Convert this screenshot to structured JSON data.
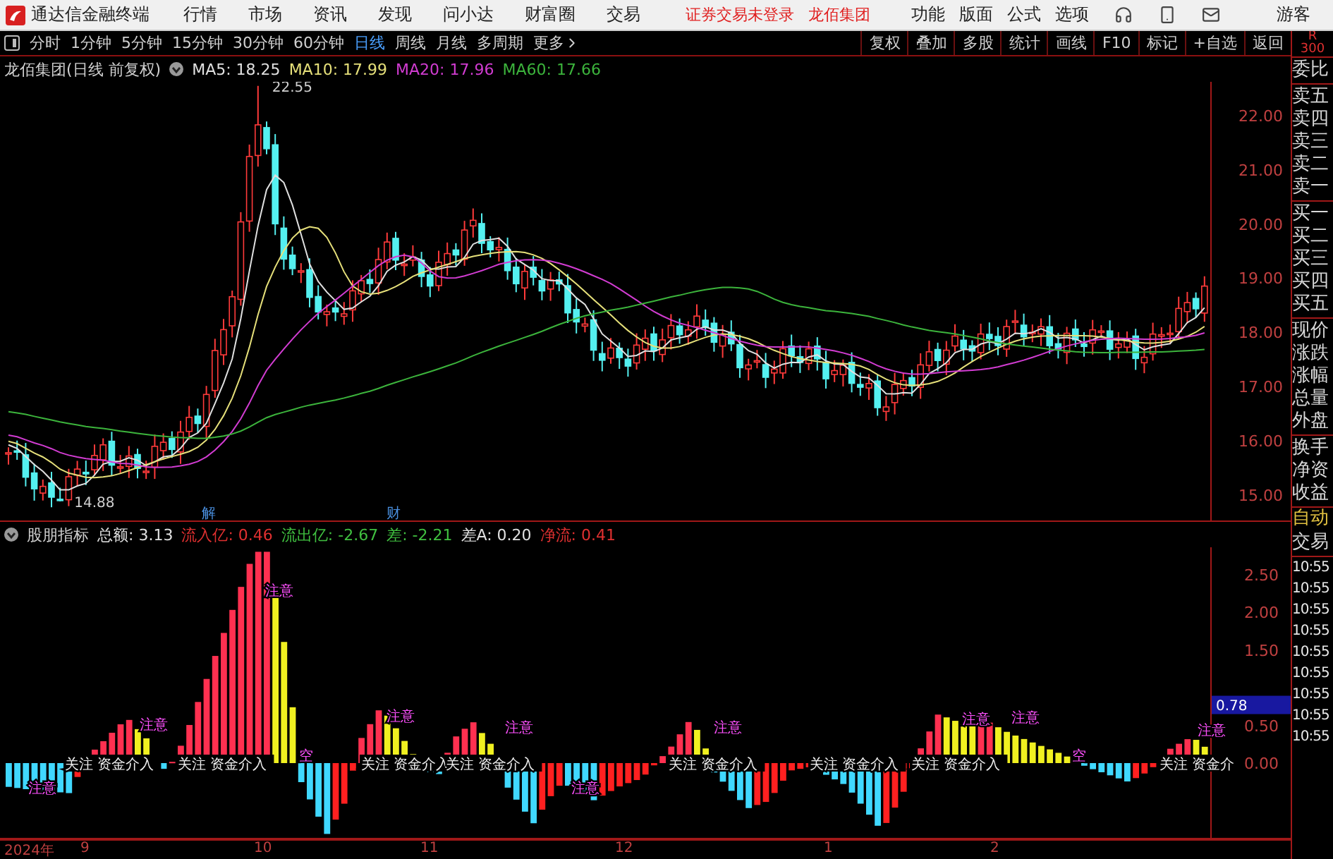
{
  "menu_bar": {
    "app_title": "通达信金融终端",
    "menus": [
      "行情",
      "市场",
      "资讯",
      "发现",
      "问小达",
      "财富圈",
      "交易"
    ],
    "notices": [
      "证券交易未登录",
      "龙佰集团"
    ],
    "functions": [
      "功能",
      "版面",
      "公式",
      "选项"
    ],
    "user": "游客"
  },
  "toolbar": {
    "periods": [
      {
        "label": "分时",
        "selected": false
      },
      {
        "label": "1分钟",
        "selected": false
      },
      {
        "label": "5分钟",
        "selected": false
      },
      {
        "label": "15分钟",
        "selected": false
      },
      {
        "label": "30分钟",
        "selected": false
      },
      {
        "label": "60分钟",
        "selected": false
      },
      {
        "label": "日线",
        "selected": true
      },
      {
        "label": "周线",
        "selected": false
      },
      {
        "label": "月线",
        "selected": false
      },
      {
        "label": "多周期",
        "selected": false
      }
    ],
    "more": "更多",
    "actions": [
      "复权",
      "叠加",
      "多股",
      "统计",
      "画线",
      "F10",
      "标记",
      "+自选",
      "返回"
    ]
  },
  "price_chart": {
    "title": "龙佰集团(日线 前复权)",
    "indicators": [
      {
        "label": "MA5: 18.25",
        "color": "#e0e0e0"
      },
      {
        "label": "MA10: 17.99",
        "color": "#e6e07a"
      },
      {
        "label": "MA20: 17.96",
        "color": "#d23cd2"
      },
      {
        "label": "MA60: 17.66",
        "color": "#3cb43c"
      }
    ],
    "high_label": "22.55",
    "low_label": "14.88",
    "markers": [
      "解",
      "财"
    ],
    "yticks": [
      "22.00",
      "21.00",
      "20.00",
      "19.00",
      "18.00",
      "17.00",
      "16.00",
      "15.00"
    ]
  },
  "indicator_chart": {
    "title": "股朋指标",
    "values": [
      {
        "label": "总额: 3.13",
        "color": "#e0e0e0"
      },
      {
        "label": "流入亿: 0.46",
        "color": "#e03030"
      },
      {
        "label": "流出亿: -2.67",
        "color": "#40c040"
      },
      {
        "label": "差: -2.21",
        "color": "#40c040"
      },
      {
        "label": "差A: 0.20",
        "color": "#e0e0e0"
      },
      {
        "label": "净流: 0.41",
        "color": "#e03030"
      }
    ],
    "yticks": [
      "2.50",
      "2.00",
      "1.50",
      "0.50",
      "0.00"
    ],
    "highlight": "0.78",
    "signal_labels": [
      "关注 资金介入",
      "关注 资金介入",
      "关注 资金介入",
      "关注 资金介入",
      "关注 资金介入",
      "关注 资金介入",
      "关注 资金介入",
      "关注 资金介"
    ],
    "warning_labels": [
      "注意",
      "注意",
      "注意",
      "注意",
      "注意",
      "注意",
      "注意",
      "注意",
      "注意",
      "注意"
    ],
    "empty_labels": [
      "空",
      "空"
    ]
  },
  "date_axis": [
    "2024年",
    "9",
    "10",
    "11",
    "12",
    "1",
    "2"
  ],
  "quote_panel": {
    "code_label": "R",
    "code_number": "300",
    "groups": [
      [
        "委比"
      ],
      [
        "卖五",
        "卖四",
        "卖三",
        "卖二",
        "卖一"
      ],
      [
        "买一",
        "买二",
        "买三",
        "买四",
        "买五"
      ],
      [
        "现价",
        "涨跌",
        "涨幅",
        "总量",
        "外盘"
      ],
      [
        "换手",
        "净资",
        "收益"
      ]
    ],
    "auto": "自动",
    "trade": "交易",
    "times": [
      "10:55",
      "10:55",
      "10:55",
      "10:55",
      "10:55",
      "10:55",
      "10:55",
      "10:55",
      "10:55"
    ]
  }
}
